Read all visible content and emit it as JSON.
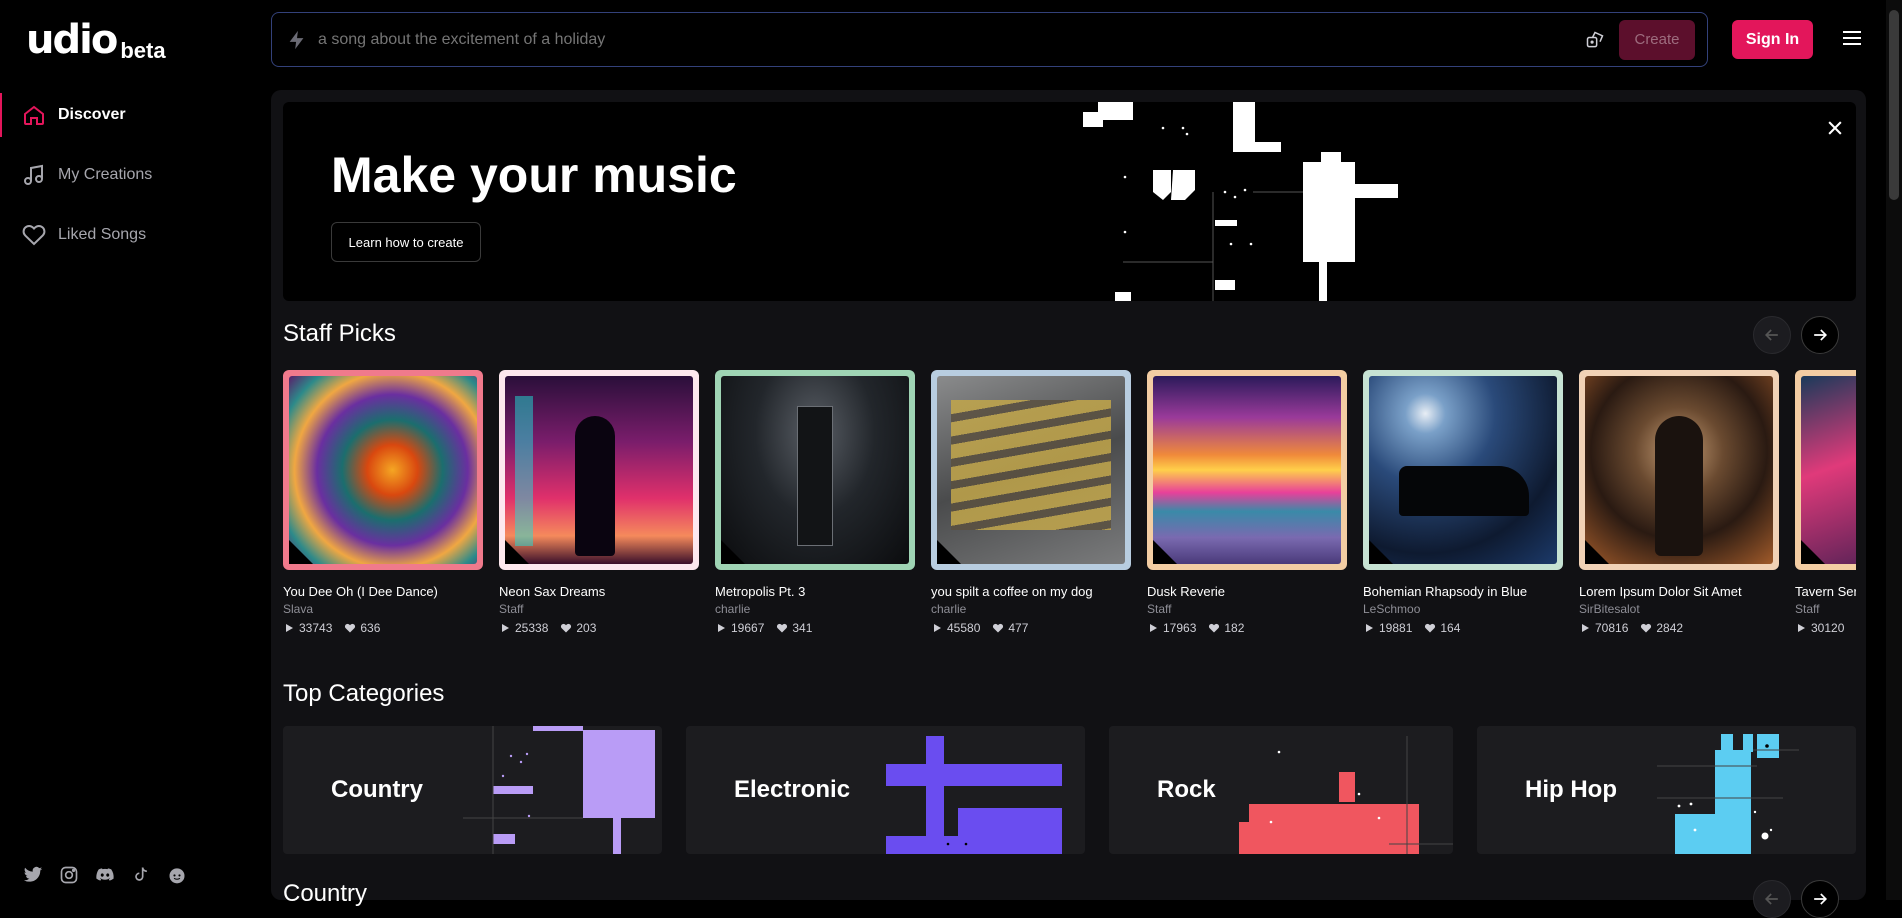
{
  "brand": {
    "logo": "udio",
    "badge": "beta"
  },
  "sidebar": {
    "items": [
      {
        "label": "Discover",
        "icon": "home-icon",
        "active": true
      },
      {
        "label": "My Creations",
        "icon": "music-note-icon",
        "active": false
      },
      {
        "label": "Liked Songs",
        "icon": "heart-icon",
        "active": false
      }
    ],
    "social": [
      "twitter-icon",
      "instagram-icon",
      "discord-icon",
      "tiktok-icon",
      "reddit-icon"
    ]
  },
  "header": {
    "placeholder": "a song about the excitement of a holiday",
    "create_label": "Create",
    "signin_label": "Sign In"
  },
  "hero": {
    "title": "Make your music",
    "button_label": "Learn how to create"
  },
  "staff_picks": {
    "title": "Staff Picks",
    "items": [
      {
        "title": "You Dee Oh (I Dee Dance)",
        "artist": "Slava",
        "plays": "33743",
        "likes": "636",
        "frame": "#f07a8c"
      },
      {
        "title": "Neon Sax Dreams",
        "artist": "Staff",
        "plays": "25338",
        "likes": "203",
        "frame": "#fde8ee"
      },
      {
        "title": "Metropolis Pt. 3",
        "artist": "charlie",
        "plays": "19667",
        "likes": "341",
        "frame": "#9fd4b4"
      },
      {
        "title": "you spilt a coffee on my dog",
        "artist": "charlie",
        "plays": "45580",
        "likes": "477",
        "frame": "#b8cde0"
      },
      {
        "title": "Dusk Reverie",
        "artist": "Staff",
        "plays": "17963",
        "likes": "182",
        "frame": "#f3cda3"
      },
      {
        "title": "Bohemian Rhapsody in Blue",
        "artist": "LeSchmoo",
        "plays": "19881",
        "likes": "164",
        "frame": "#c6e2d3"
      },
      {
        "title": "Lorem Ipsum Dolor Sit Amet",
        "artist": "SirBitesalot",
        "plays": "70816",
        "likes": "2842",
        "frame": "#f1d2b6"
      },
      {
        "title": "Tavern Ser",
        "artist": "Staff",
        "plays": "30120",
        "likes": "",
        "frame": "#f3cda3"
      }
    ]
  },
  "top_categories": {
    "title": "Top Categories",
    "items": [
      {
        "label": "Country",
        "color": "#b99cf6"
      },
      {
        "label": "Electronic",
        "color": "#6a4df0"
      },
      {
        "label": "Rock",
        "color": "#f0565f"
      },
      {
        "label": "Hip Hop",
        "color": "#5ccdf2"
      }
    ]
  },
  "next_section": {
    "title": "Country"
  }
}
